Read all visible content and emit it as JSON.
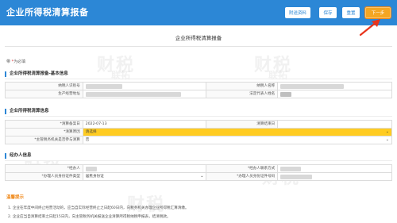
{
  "header": {
    "app_title": "企业所得税清算报备",
    "buttons": [
      "附送资料",
      "保存",
      "重置",
      "下一步"
    ]
  },
  "page": {
    "title": "企业所得税清算报备",
    "required_note_mark": "带",
    "required_note_star": "*",
    "required_note_text": "为必填"
  },
  "sections": {
    "basic": {
      "title": "企业所得税清算报备-基本信息",
      "labels": {
        "taxpayer_id": "纳税人识别号",
        "taxpayer_name": "纳税人名称",
        "business_address": "生产经营地址",
        "legal_rep": "法定代表人姓名"
      }
    },
    "liquidation": {
      "title": "企业所得税清算信息",
      "labels": {
        "start_date": "*清算备案日",
        "end_date": "清算结束日",
        "reason": "*清算原因",
        "concurrent": "*主管税务机关是否参与清算"
      },
      "values": {
        "start_date": "2022-07-13",
        "end_date": "",
        "reason": "请选择",
        "concurrent": "否"
      }
    },
    "agent": {
      "title": "经办人信息",
      "labels": {
        "agent": "*经办人",
        "contact": "*经办人联系方式",
        "id_type": "*办理人员身份证件类型",
        "id_number": "*办理人员身份证件号码"
      },
      "values": {
        "id_type": "居民身份证"
      }
    }
  },
  "tips": {
    "title": "温馨提示",
    "items": [
      "1. 企业在年度中间终止经营活动的，应当自实际经营终止之日起60日内，向税务机关办理企业所得税汇算清缴。",
      "2. 企业应当自清算结束之日起15日内，向主管税务机关报送企业清算所得税纳税申报表，结清税款。"
    ]
  },
  "watermark": {
    "text_1": "财税",
    "text_2": "联拓"
  },
  "colors": {
    "header_bg": "#2c87d6",
    "primary_button": "#f5a623",
    "highlight_field": "#ffcc22",
    "warning_text": "#f08a1c",
    "arrow": "#e8341c"
  }
}
